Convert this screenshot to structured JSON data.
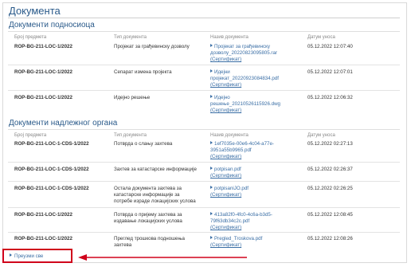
{
  "page": {
    "title": "Документа"
  },
  "section1": {
    "title": "Документи подносиоца",
    "headers": {
      "case_no": "Број предмета",
      "doc_type": "Тип документа",
      "doc_name": "Назив документа",
      "date": "Датум уноса"
    },
    "rows": [
      {
        "case_no": "ROP-BG-211-LOC-1/2022",
        "doc_type": "Пројекат за грађевинску дозволу",
        "doc_name_1": "Пројекат за грађевинску",
        "doc_name_2": "дозволу_20220823095805.rar",
        "cert": "(Сертификат)",
        "date": "05.12.2022 12:07:40"
      },
      {
        "case_no": "ROP-BG-211-LOC-1/2022",
        "doc_type": "Сепарат измена пројекта",
        "doc_name_1": "Идејни",
        "doc_name_2": "пројекат_20220923084834.pdf",
        "cert": "(Сертификат)",
        "date": "05.12.2022 12:07:01"
      },
      {
        "case_no": "ROP-BG-211-LOC-1/2022",
        "doc_type": "Идејно решење",
        "doc_name_1": "Идејно",
        "doc_name_2": "решење_20210526115926.dwg",
        "cert": "(Сертификат)",
        "date": "05.12.2022 12:06:32"
      }
    ]
  },
  "section2": {
    "title": "Документи надлежног органа",
    "headers": {
      "case_no": "Број предмета",
      "doc_type": "Тип документа",
      "doc_name": "Назив документа",
      "date": "Датум уноса"
    },
    "rows": [
      {
        "case_no": "ROP-BG-211-LOC-1-CDS-1/2022",
        "doc_type_1": "Потврда о слању захтева",
        "doc_type_2": "",
        "doc_type_3": "",
        "doc_name_1": "1ef7035e-00e6-4c04-a77e-",
        "doc_name_2": "3951a55b9965.pdf",
        "cert": "(Сертификат)",
        "date": "05.12.2022 02:27:13"
      },
      {
        "case_no": "ROP-BG-211-LOC-1-CDS-1/2022",
        "doc_type_1": "Захтев за катастарске информације",
        "doc_type_2": "",
        "doc_type_3": "",
        "doc_name_1": "potpisan.pdf",
        "doc_name_2": "",
        "cert": "(Сертификат)",
        "date": "05.12.2022 02:26:37"
      },
      {
        "case_no": "ROP-BG-211-LOC-1-CDS-1/2022",
        "doc_type_1": "Остала документа захтева за",
        "doc_type_2": "катастарске информације за",
        "doc_type_3": "потребе израде локацијских услова",
        "doc_name_1": "potpisaniJO.pdf",
        "doc_name_2": "",
        "cert": "(Сертификат)",
        "date": "05.12.2022 02:26:25"
      },
      {
        "case_no": "ROP-BG-211-LOC-1/2022",
        "doc_type_1": "Потврда о пријему захтева за",
        "doc_type_2": "издавање локацијских услова",
        "doc_type_3": "",
        "doc_name_1": "413a82f0-4fc0-4c6a-b3d5-",
        "doc_name_2": "79f63db34c2c.pdf",
        "cert": "(Сертификат)",
        "date": "05.12.2022 12:08:45"
      },
      {
        "case_no": "ROP-BG-211-LOC-1/2022",
        "doc_type_1": "Преглед трошкова подношења",
        "doc_type_2": "захтева",
        "doc_type_3": "",
        "doc_name_1": "Pregled_Troskova.pdf",
        "doc_name_2": "",
        "cert": "(Сертификат)",
        "date": "05.12.2022 12:08:26"
      }
    ]
  },
  "download_all": "Преузми све",
  "colors": {
    "link": "#3a6ea5",
    "heading": "#2a5a8a",
    "highlight": "#d0021b"
  }
}
